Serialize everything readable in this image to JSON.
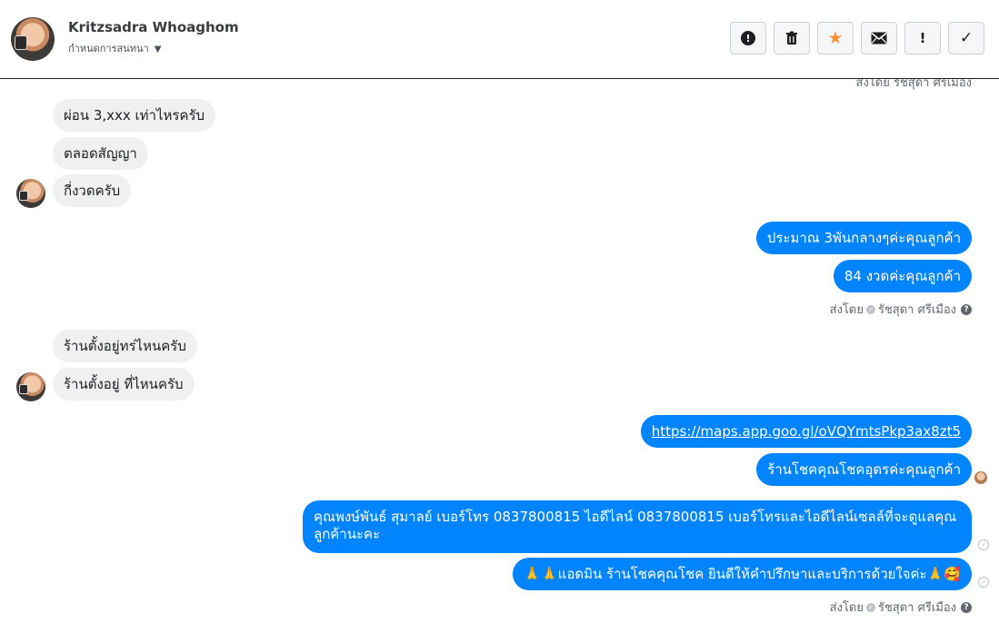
{
  "header": {
    "name": "Kritzsadra Whoaghom",
    "subtitle": "กำหนดการสนทนา",
    "actions": [
      {
        "icon": "alert-circle-icon",
        "glyph": "!"
      },
      {
        "icon": "trash-icon",
        "glyph": "🗑"
      },
      {
        "icon": "star-icon",
        "glyph": "★"
      },
      {
        "icon": "envelope-icon",
        "glyph": "✉"
      },
      {
        "icon": "exclamation-icon",
        "glyph": "!"
      },
      {
        "icon": "check-icon",
        "glyph": "✓"
      }
    ]
  },
  "partial_top_meta": "ส่งโดย รัชสุดา ศรีเมือง",
  "messages": {
    "in1": "ผ่อน 3,xxx เท่าไหรครับ",
    "in2": "ตลอดสัญญา",
    "in3": "กี่งวดครับ",
    "out1": "ประมาณ 3พันกลางๆค่ะคุณลูกค้า",
    "out2": "84 งวดค่ะคุณลูกค้า",
    "in4": "ร้านตั้งอยู่ทร่ไหนครับ",
    "in5": "ร้านตั้งอยู่ ที่ไหนครับ",
    "out3": "https://maps.app.goo.gl/oVQYmtsPkp3ax8zt5",
    "out4": "ร้านโชคคุณโชคอุดรค่ะคุณลูกค้า",
    "out5": "คุณพงษ์พันธ์ สุมาลย์      เบอร์โทร 0837800815  ไอดีไลน์ 0837800815   เบอร์โทรและไอดีไลน์เซลล์ที่จะดูแลคุณลูกค้านะคะ",
    "out6": "🙏🙏แอดมิน ร้านโชคคุณโชค ยินดีให้คำปรึกษาและบริการด้วยใจค่ะ🙏🥰"
  },
  "sent_by": {
    "label": "ส่งโดย",
    "agent": "รัชสุดา ศรีเมือง"
  }
}
